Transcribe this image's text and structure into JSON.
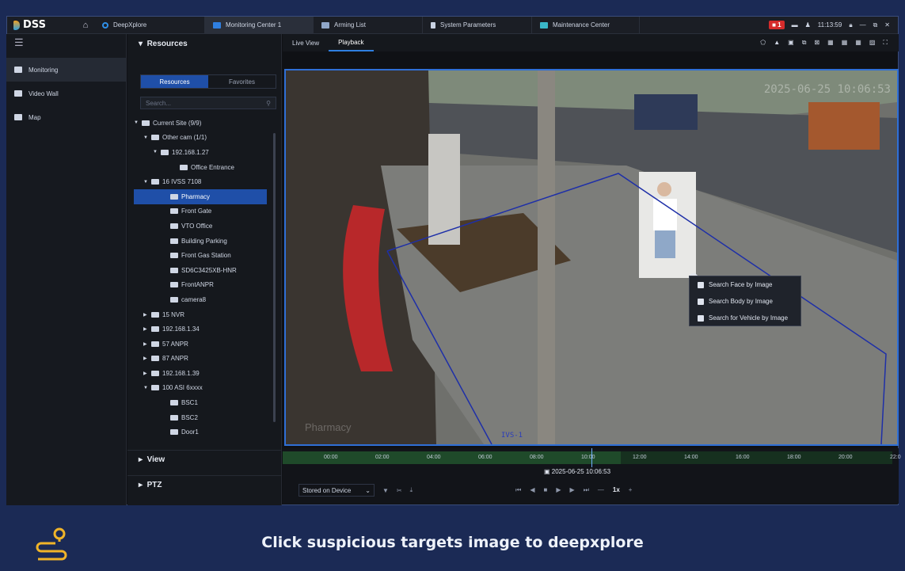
{
  "app": {
    "logo": "DSS"
  },
  "tabs": [
    {
      "label": "DeepXplore",
      "color": "#2f8fe8"
    },
    {
      "label": "Monitoring Center 1",
      "color": "#2f7fe0"
    },
    {
      "label": "Arming List",
      "color": "#8fa6c8"
    },
    {
      "label": "System Parameters",
      "color": "#c9d2e2"
    },
    {
      "label": "Maintenance Center",
      "color": "#3ab7c8"
    }
  ],
  "topbar": {
    "alarm_count": "1",
    "time": "11:13:59"
  },
  "leftnav": [
    {
      "label": "Monitoring"
    },
    {
      "label": "Video Wall"
    },
    {
      "label": "Map"
    }
  ],
  "resources": {
    "title": "Resources",
    "tab_resources": "Resources",
    "tab_favorites": "Favorites",
    "search_placeholder": "Search...",
    "tree": [
      {
        "label": "Current Site (9/9)",
        "indent": 0,
        "caret": "▼"
      },
      {
        "label": "Other cam (1/1)",
        "indent": 1,
        "caret": "▼"
      },
      {
        "label": "192.168.1.27",
        "indent": 2,
        "caret": "▼"
      },
      {
        "label": "Office Entrance",
        "indent": 4,
        "caret": ""
      },
      {
        "label": "16 IVSS 7108",
        "indent": 1,
        "caret": "▼"
      },
      {
        "label": "Pharmacy",
        "indent": 3,
        "caret": "",
        "selected": true
      },
      {
        "label": "Front Gate",
        "indent": 3,
        "caret": ""
      },
      {
        "label": "VTO Office",
        "indent": 3,
        "caret": ""
      },
      {
        "label": "Building Parking",
        "indent": 3,
        "caret": ""
      },
      {
        "label": "Front Gas Station",
        "indent": 3,
        "caret": ""
      },
      {
        "label": "SD6C3425XB-HNR",
        "indent": 3,
        "caret": ""
      },
      {
        "label": "FrontANPR",
        "indent": 3,
        "caret": ""
      },
      {
        "label": "camera8",
        "indent": 3,
        "caret": ""
      },
      {
        "label": "15 NVR",
        "indent": 1,
        "caret": "▶"
      },
      {
        "label": "192.168.1.34",
        "indent": 1,
        "caret": "▶"
      },
      {
        "label": "57 ANPR",
        "indent": 1,
        "caret": "▶"
      },
      {
        "label": "87 ANPR",
        "indent": 1,
        "caret": "▶"
      },
      {
        "label": "192.168.1.39",
        "indent": 1,
        "caret": "▶"
      },
      {
        "label": "100 ASI 6xxxx",
        "indent": 1,
        "caret": "▼"
      },
      {
        "label": "BSC1",
        "indent": 3,
        "caret": ""
      },
      {
        "label": "BSC2",
        "indent": 3,
        "caret": ""
      },
      {
        "label": "Door1",
        "indent": 3,
        "caret": ""
      }
    ]
  },
  "panels": {
    "view": "View",
    "ptz": "PTZ"
  },
  "video_tabs": {
    "live": "Live View",
    "playback": "Playback"
  },
  "video": {
    "timestamp": "2025-06-25 10:06:53",
    "camera_label": "Pharmacy",
    "rule_label": "IVS-1"
  },
  "context_menu": [
    {
      "label": "Search Face by Image"
    },
    {
      "label": "Search Body by Image"
    },
    {
      "label": "Search for Vehicle by Image"
    }
  ],
  "timeline": {
    "ticks": [
      "00:00",
      "02:00",
      "04:00",
      "06:00",
      "08:00",
      "10:00",
      "12:00",
      "14:00",
      "16:00",
      "18:00",
      "20:00",
      "22:0"
    ],
    "current": "2025-06-25 10:06:53",
    "storage": "Stored on Device",
    "speed": "1x"
  },
  "caption": "Click suspicious targets image to deepxplore"
}
